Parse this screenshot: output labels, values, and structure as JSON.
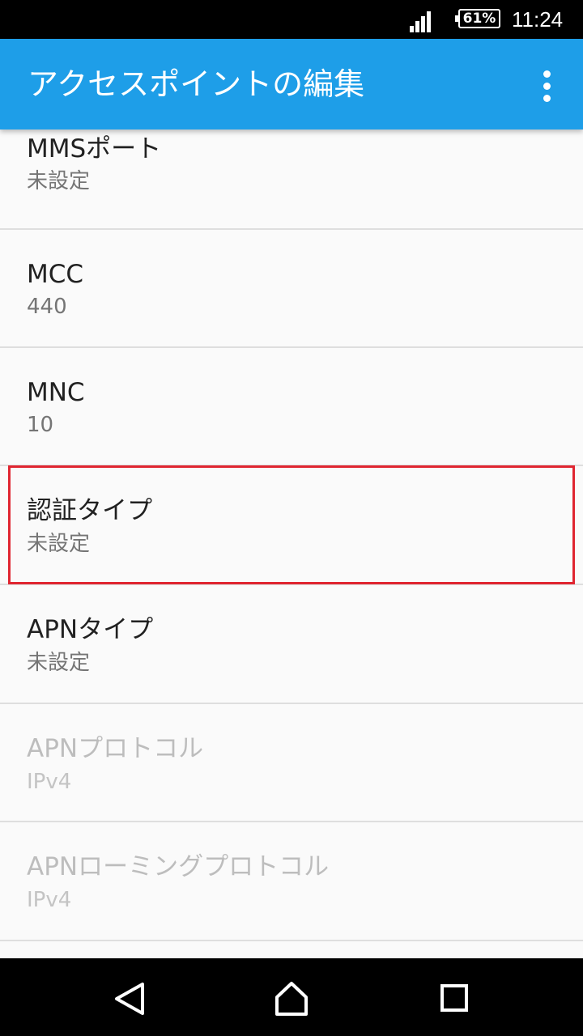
{
  "status_bar": {
    "battery": "61%",
    "time": "11:24",
    "signal_icon": "signal-strength-icon"
  },
  "app_bar": {
    "title": "アクセスポイントの編集",
    "overflow_icon": "more-vert-icon"
  },
  "settings": [
    {
      "title": "MMSポート",
      "value": "未設定",
      "enabled": true
    },
    {
      "title": "MCC",
      "value": "440",
      "enabled": true
    },
    {
      "title": "MNC",
      "value": "10",
      "enabled": true
    },
    {
      "title": "認証タイプ",
      "value": "未設定",
      "enabled": true,
      "highlighted": true
    },
    {
      "title": "APNタイプ",
      "value": "未設定",
      "enabled": true
    },
    {
      "title": "APNプロトコル",
      "value": "IPv4",
      "enabled": false
    },
    {
      "title": "APNローミングプロトコル",
      "value": "IPv4",
      "enabled": false
    }
  ],
  "highlight_color": "#e02530",
  "accent_color": "#1e9ee8",
  "nav_bar": {
    "back_icon": "back-triangle-icon",
    "home_icon": "home-icon",
    "recents_icon": "recents-square-icon"
  }
}
